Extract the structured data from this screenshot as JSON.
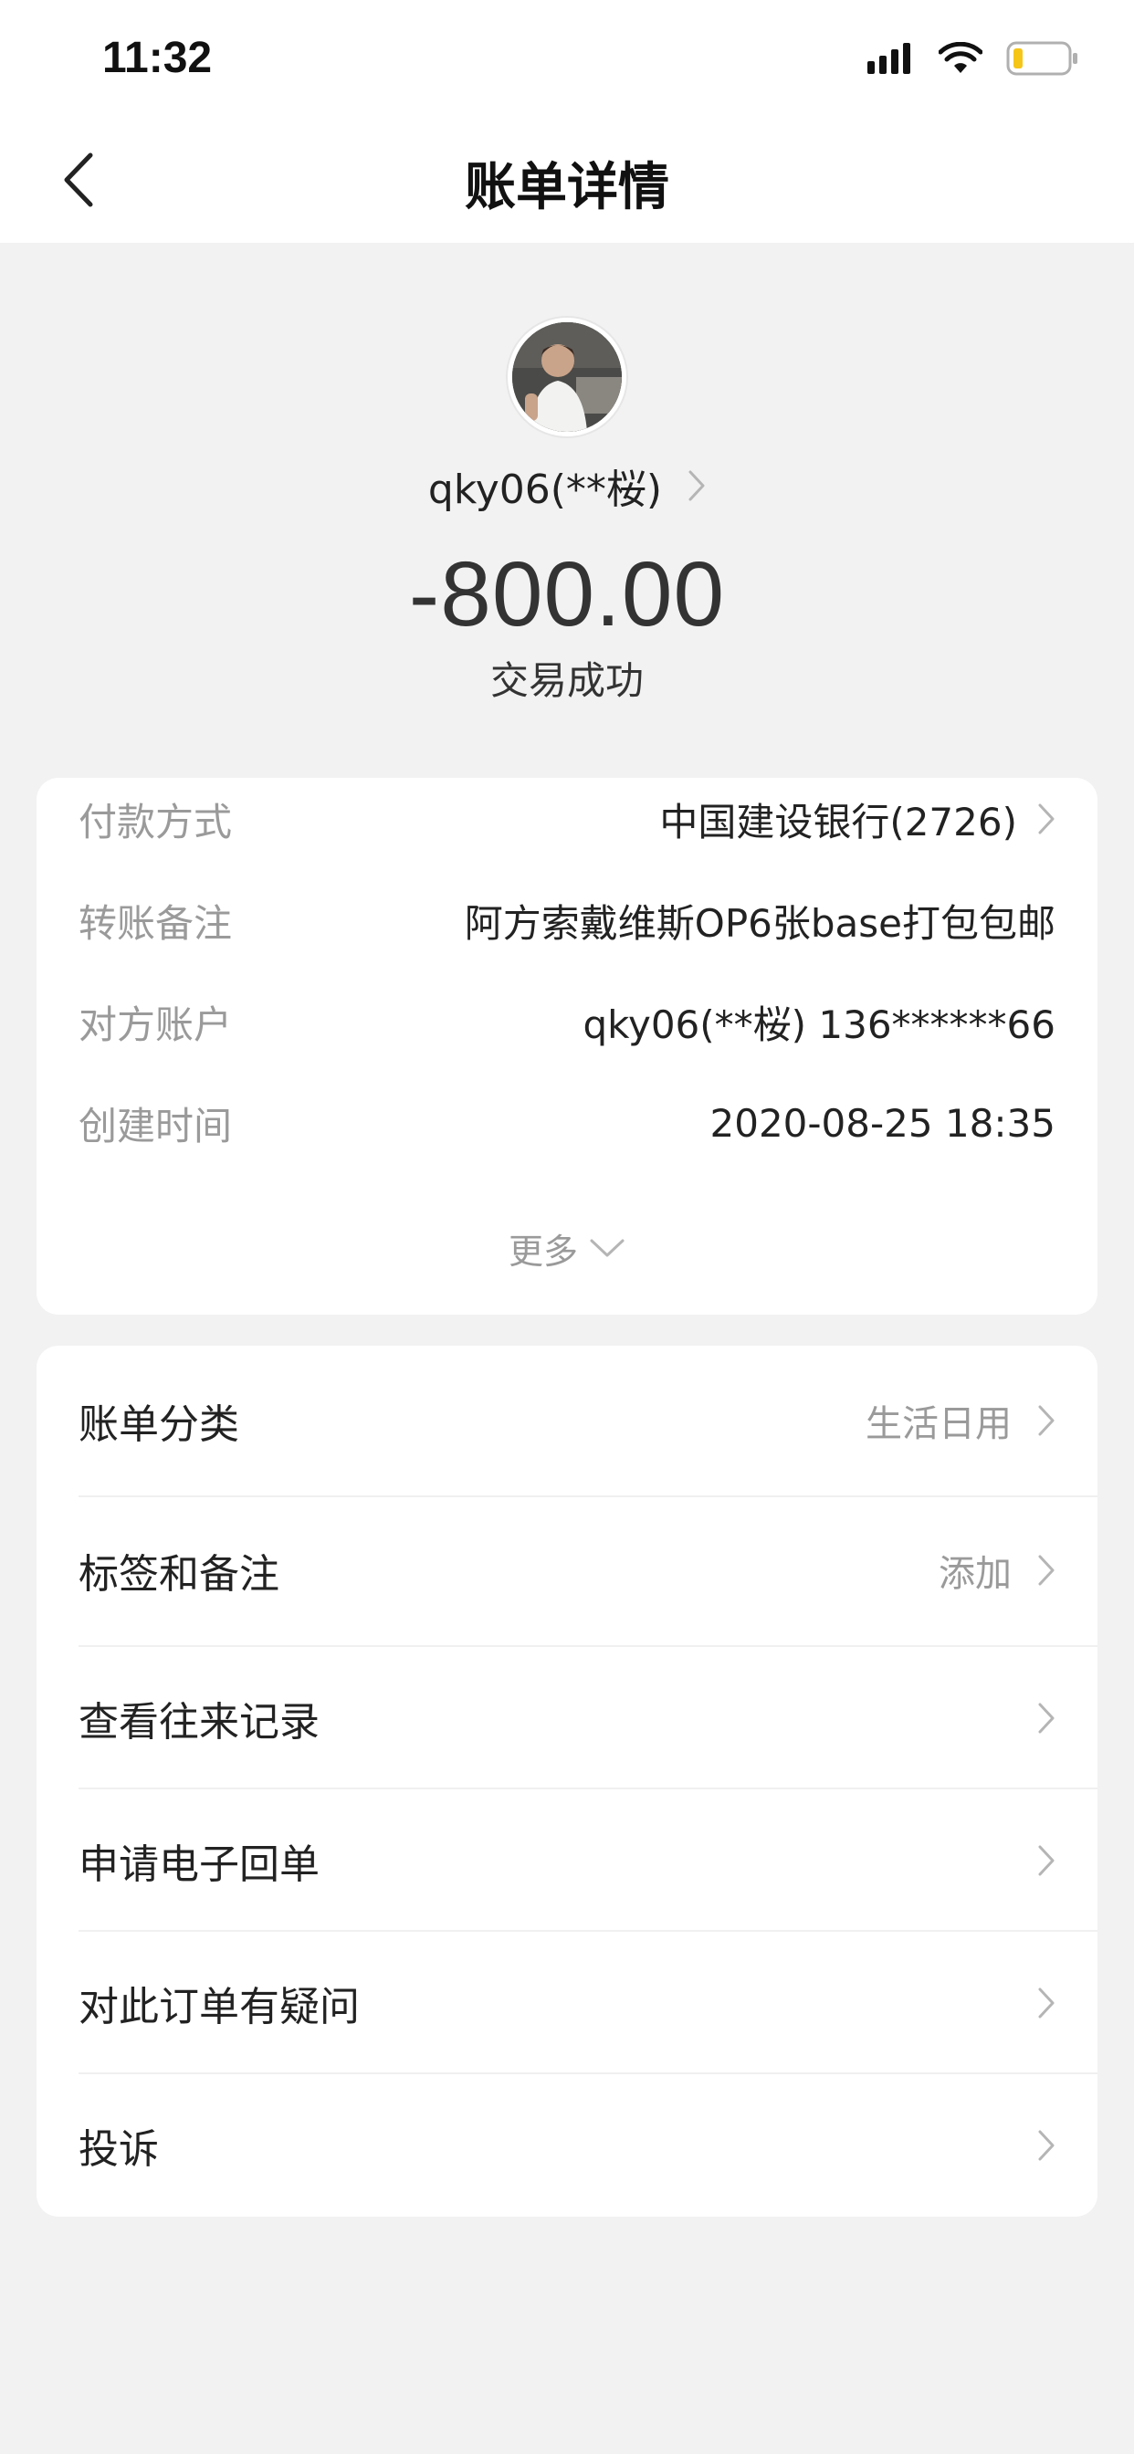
{
  "status_bar": {
    "time": "11:32"
  },
  "nav": {
    "title": "账单详情"
  },
  "header": {
    "payee": "qky06(**桜)",
    "amount": "-800.00",
    "status": "交易成功"
  },
  "details": {
    "rows": [
      {
        "label": "付款方式",
        "value": "中国建设银行(2726)"
      },
      {
        "label": "转账备注",
        "value": "阿方索戴维斯OP6张base打包包邮"
      },
      {
        "label": "对方账户",
        "value": "qky06(**桜) 136******66"
      },
      {
        "label": "创建时间",
        "value": "2020-08-25 18:35"
      }
    ],
    "more_label": "更多"
  },
  "actions": [
    {
      "label": "账单分类",
      "value": "生活日用"
    },
    {
      "label": "标签和备注",
      "value": "添加"
    },
    {
      "label": "查看往来记录",
      "value": ""
    },
    {
      "label": "申请电子回单",
      "value": ""
    },
    {
      "label": "对此订单有疑问",
      "value": ""
    },
    {
      "label": "投诉",
      "value": ""
    }
  ],
  "colors": {
    "background": "#f2f2f2",
    "card": "#ffffff",
    "muted_text": "#9a9a9a",
    "primary_text": "#222222",
    "battery_low": "#f5c518"
  }
}
